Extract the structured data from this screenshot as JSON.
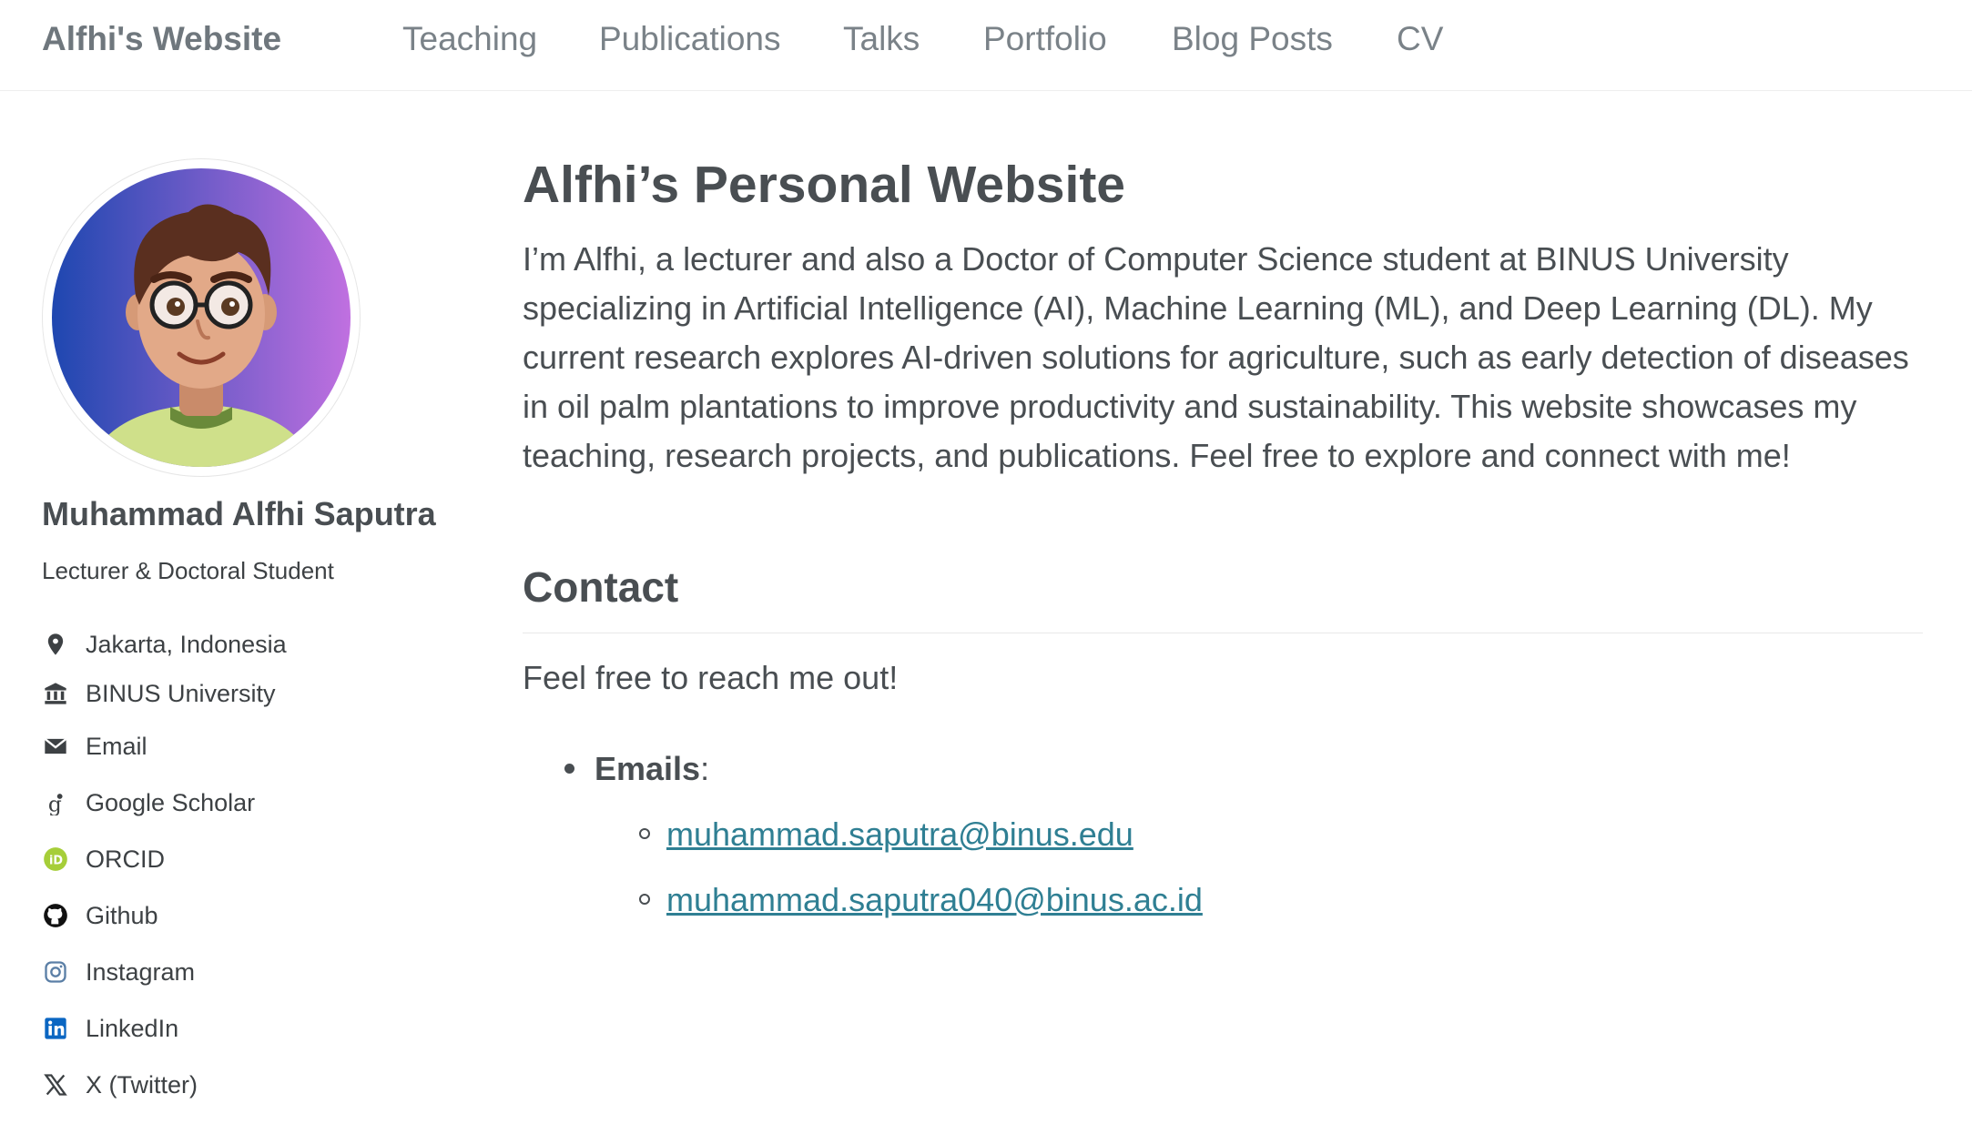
{
  "masthead": {
    "site_title": "Alfhi's Website",
    "nav": [
      {
        "label": "Teaching"
      },
      {
        "label": "Publications"
      },
      {
        "label": "Talks"
      },
      {
        "label": "Portfolio"
      },
      {
        "label": "Blog Posts"
      },
      {
        "label": "CV"
      }
    ]
  },
  "sidebar": {
    "name": "Muhammad Alfhi Saputra",
    "bio": "Lecturer & Doctoral Student",
    "items": [
      {
        "label": "Jakarta, Indonesia",
        "icon": "map-marker-icon"
      },
      {
        "label": "BINUS University",
        "icon": "university-icon"
      },
      {
        "label": "Email",
        "icon": "envelope-icon"
      },
      {
        "label": "Google Scholar",
        "icon": "google-scholar-icon"
      },
      {
        "label": "ORCID",
        "icon": "orcid-icon"
      },
      {
        "label": "Github",
        "icon": "github-icon"
      },
      {
        "label": "Instagram",
        "icon": "instagram-icon"
      },
      {
        "label": "LinkedIn",
        "icon": "linkedin-icon"
      },
      {
        "label": "X (Twitter)",
        "icon": "x-twitter-icon"
      }
    ]
  },
  "main": {
    "title": "Alfhi’s Personal Website",
    "intro": "I’m Alfhi, a lecturer and also a Doctor of Computer Science student at BINUS University specializing in Artificial Intelligence (AI), Machine Learning (ML), and Deep Learning (DL). My current research explores AI-driven solutions for agriculture, such as early detection of diseases in oil palm plantations to improve productivity and sustainability. This website showcases my teaching, research projects, and publications. Feel free to explore and connect with me!",
    "contact": {
      "heading": "Contact",
      "text": "Feel free to reach me out!",
      "emails_label": "Emails",
      "emails": [
        "muhammad.saputra@binus.edu",
        "muhammad.saputra040@binus.ac.id"
      ]
    }
  },
  "colors": {
    "link": "#2f7f93",
    "orcid": "#a6ce39",
    "linkedin": "#0a66c2",
    "instagram": "#5b7fa6",
    "avatar_gradient_start": "#1e47b0",
    "avatar_gradient_end": "#c070e0"
  }
}
